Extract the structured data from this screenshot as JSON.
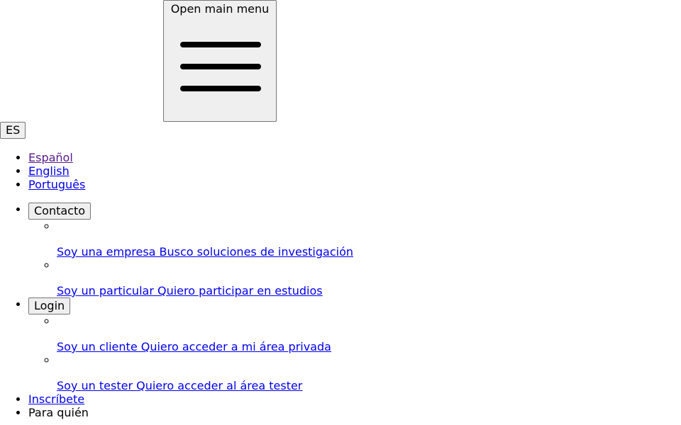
{
  "header": {
    "menu_button_label": "Open main menu",
    "language_button_label": "ES"
  },
  "languages": [
    {
      "label": "Español",
      "visited": true
    },
    {
      "label": "English",
      "visited": false
    },
    {
      "label": "Português",
      "visited": false
    }
  ],
  "nav": {
    "contact": {
      "label": "Contacto",
      "items": [
        {
          "label": "Soy una empresa Busco soluciones de investigación"
        },
        {
          "label": "Soy un particular Quiero participar en estudios"
        }
      ]
    },
    "login": {
      "label": "Login",
      "items": [
        {
          "label": "Soy un cliente Quiero acceder a mi área privada"
        },
        {
          "label": "Soy un tester Quiero acceder al área tester"
        }
      ]
    },
    "signup_label": "Inscríbete",
    "cut_item_label": "Para quién"
  },
  "colors": {
    "link": "#0000ee",
    "visited_link": "#551a8b",
    "button_bg": "#efefef",
    "button_border": "#767676"
  },
  "icons": {
    "menu": "hamburger-icon"
  }
}
